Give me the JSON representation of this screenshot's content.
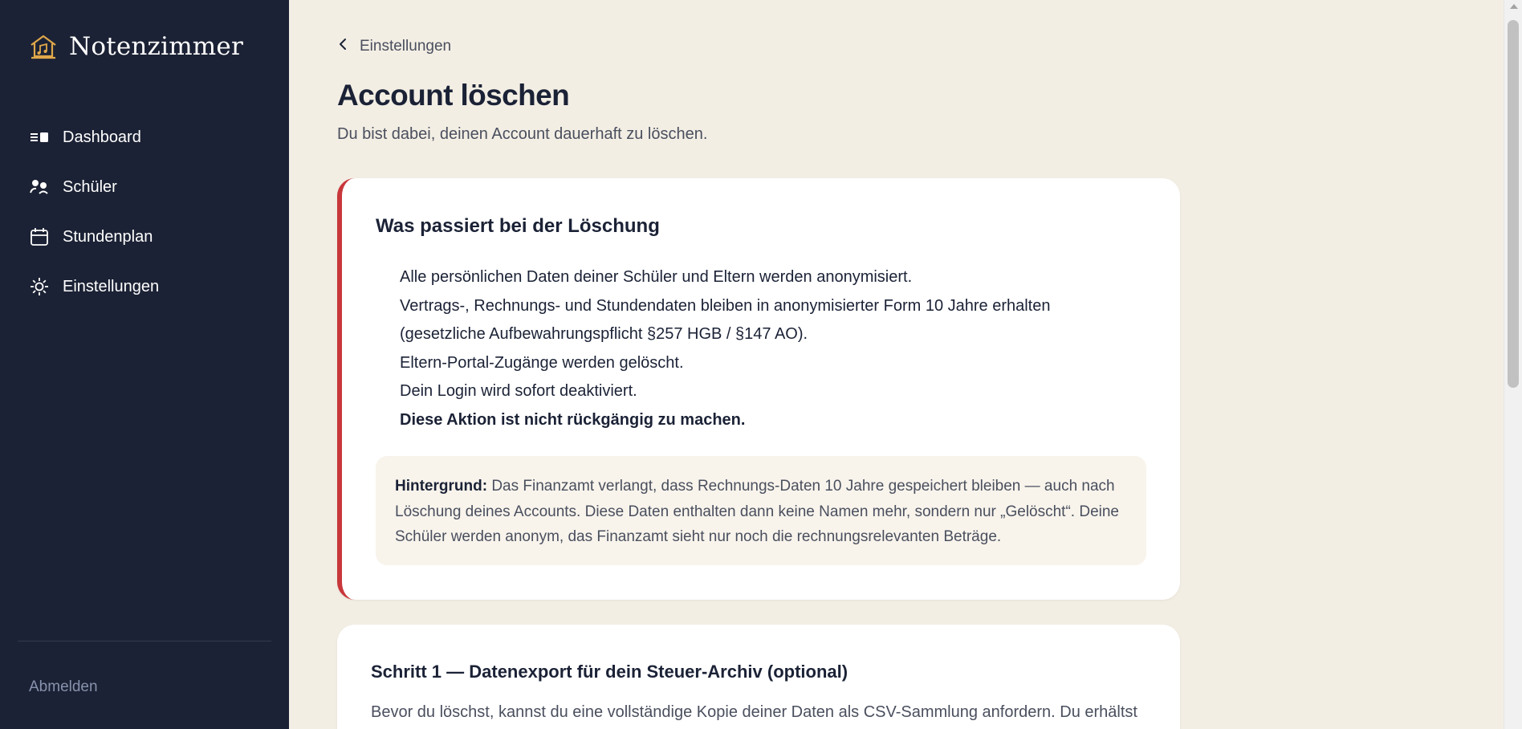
{
  "sidebar": {
    "brand": "Notenzimmer",
    "items": [
      {
        "label": "Dashboard",
        "icon": "dashboard-icon"
      },
      {
        "label": "Schüler",
        "icon": "students-icon"
      },
      {
        "label": "Stundenplan",
        "icon": "calendar-icon"
      },
      {
        "label": "Einstellungen",
        "icon": "settings-icon"
      }
    ],
    "logout": "Abmelden"
  },
  "header": {
    "breadcrumb": "Einstellungen",
    "title": "Account löschen",
    "subtitle": "Du bist dabei, deinen Account dauerhaft zu löschen."
  },
  "warning_card": {
    "title": "Was passiert bei der Löschung",
    "items": [
      "Alle persönlichen Daten deiner Schüler und Eltern werden anonymisiert.",
      "Vertrags-, Rechnungs- und Stundendaten bleiben in anonymisierter Form 10 Jahre erhalten (gesetzliche Aufbewahrungspflicht §257 HGB / §147 AO).",
      "Eltern-Portal-Zugänge werden gelöscht.",
      "Dein Login wird sofort deaktiviert.",
      "Diese Aktion ist nicht rückgängig zu machen."
    ],
    "background_label": "Hintergrund:",
    "background_text": "Das Finanzamt verlangt, dass Rechnungs-Daten 10 Jahre gespeichert bleiben — auch nach Löschung deines Accounts. Diese Daten enthalten dann keine Namen mehr, sondern nur „Gelöscht“. Deine Schüler werden anonym, das Finanzamt sieht nur noch die rechnungsrelevanten Beträge."
  },
  "step1": {
    "title": "Schritt 1 — Datenexport für dein Steuer-Archiv (optional)",
    "text": "Bevor du löschst, kannst du eine vollständige Kopie deiner Daten als CSV-Sammlung anfordern. Du erhältst"
  },
  "colors": {
    "sidebar_bg": "#1c2235",
    "page_bg": "#f3eee4",
    "danger_accent": "#c8373a",
    "brand_gold": "#e0a84a"
  }
}
